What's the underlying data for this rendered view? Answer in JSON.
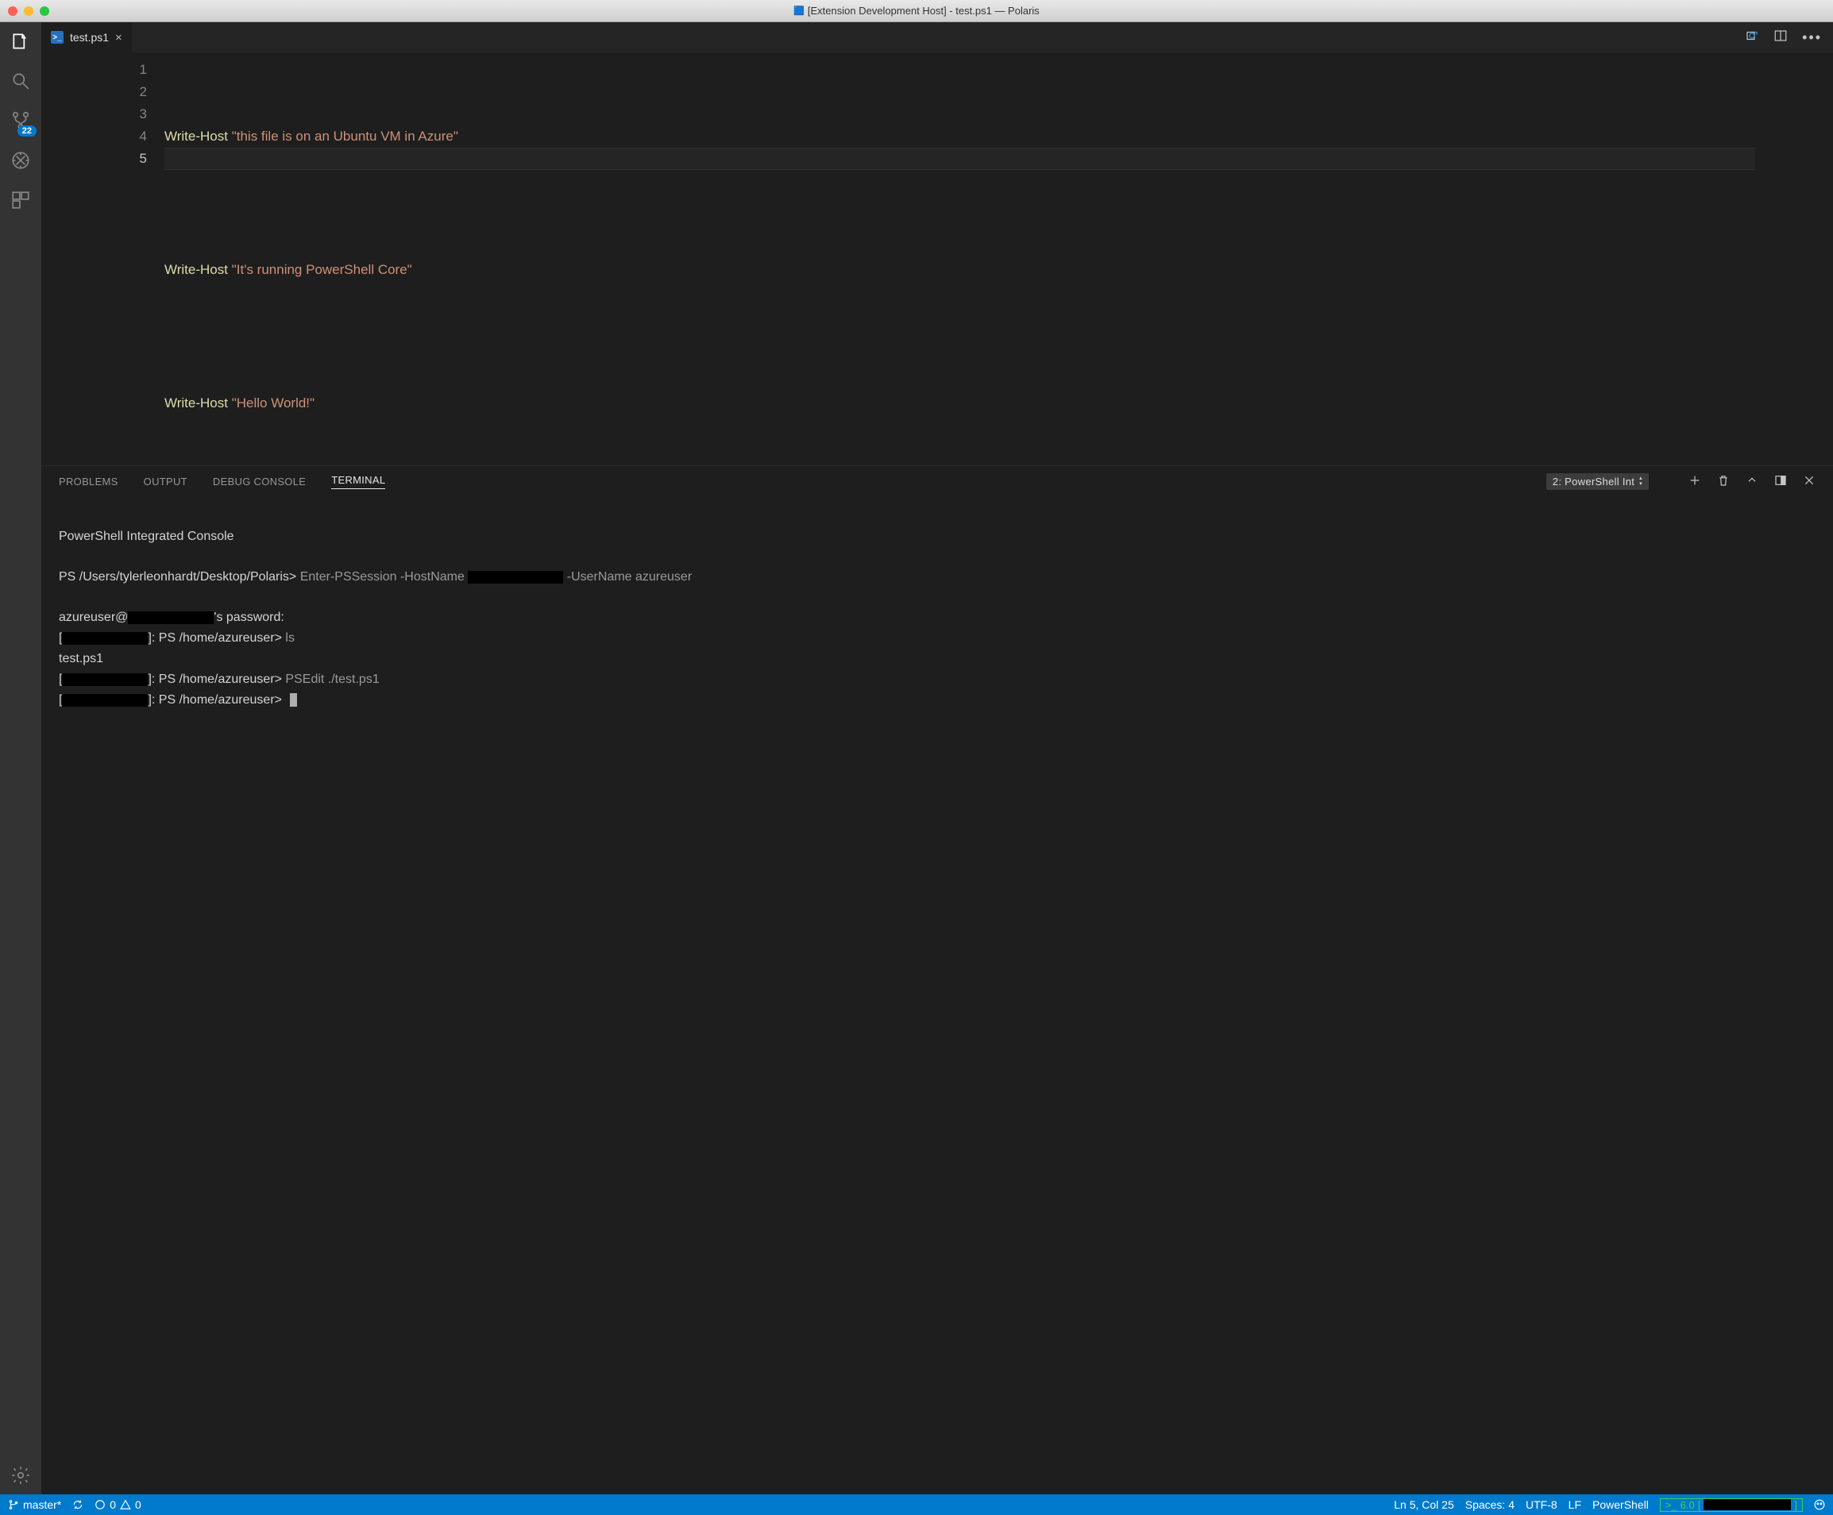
{
  "titlebar": {
    "title": "[Extension Development Host] - test.ps1 — Polaris"
  },
  "activity": {
    "scm_badge": "22"
  },
  "tab": {
    "filename": "test.ps1"
  },
  "editor": {
    "lines": [
      "1",
      "2",
      "3",
      "4",
      "5"
    ],
    "l1_cmd": "Write-Host",
    "l1_str": "\"this file is on an Ubuntu VM in Azure\"",
    "l3_cmd": "Write-Host",
    "l3_str": "\"It's running PowerShell Core\"",
    "l5_cmd": "Write-Host",
    "l5_str": "\"Hello World!\""
  },
  "panel": {
    "problems": "PROBLEMS",
    "output": "OUTPUT",
    "debug": "DEBUG CONSOLE",
    "terminal": "TERMINAL",
    "term_selected": "2: PowerShell Int"
  },
  "terminal": {
    "banner": "PowerShell Integrated Console",
    "prompt1_a": "PS /Users/tylerleonhardt/Desktop/Polaris>",
    "cmd1": " Enter-PSSession -HostName ",
    "cmd1_b": " -UserName azureuser",
    "pwline_a": "azureuser@",
    "pwline_b": "'s password:",
    "pr2_a": "[",
    "pr2_b": "]: PS /home/azureuser>",
    "cmd2": " ls",
    "out2": "test.ps1",
    "cmd3": " PSEdit ./test.ps1"
  },
  "status": {
    "branch": "master*",
    "errors": "0",
    "warnings": "0",
    "lncol": "Ln 5, Col 25",
    "spaces": "Spaces: 4",
    "encoding": "UTF-8",
    "eol": "LF",
    "language": "PowerShell",
    "ps_ver": "6.0"
  }
}
